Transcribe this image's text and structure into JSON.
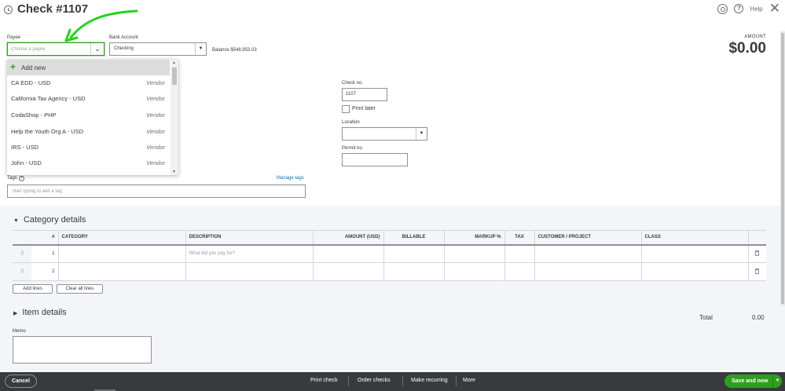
{
  "header": {
    "title": "Check #1107",
    "help_label": "Help"
  },
  "payee": {
    "label": "Payee",
    "placeholder": "Choose a payee"
  },
  "bank_account": {
    "label": "Bank Account",
    "value": "Checking",
    "balance": "Balance $548,953.03"
  },
  "amount": {
    "label": "AMOUNT",
    "value": "$0.00"
  },
  "payee_dropdown": {
    "add_new": "Add new",
    "items": [
      {
        "name": "CA EDD  - USD",
        "type": "Vendor"
      },
      {
        "name": "California Tax Agency  - USD",
        "type": "Vendor"
      },
      {
        "name": "CodaShop  - PHP",
        "type": "Vendor"
      },
      {
        "name": "Help the Youth Org A  - USD",
        "type": "Vendor"
      },
      {
        "name": "IRS  - USD",
        "type": "Vendor"
      },
      {
        "name": "John  - USD",
        "type": "Vendor"
      }
    ]
  },
  "check_no": {
    "label": "Check no.",
    "value": "1107"
  },
  "print_later": {
    "label": "Print later"
  },
  "location": {
    "label": "Location"
  },
  "permit": {
    "label": "Permit no."
  },
  "tags": {
    "label": "Tags",
    "manage": "Manage tags",
    "placeholder": "Start typing to add a tag"
  },
  "category_details": {
    "title": "Category details",
    "columns": [
      "#",
      "CATEGORY",
      "DESCRIPTION",
      "AMOUNT (USD)",
      "BILLABLE",
      "MARKUP %",
      "TAX",
      "CUSTOMER / PROJECT",
      "CLASS"
    ],
    "rows": [
      {
        "num": "1",
        "description_placeholder": "What did you pay for?"
      },
      {
        "num": "2",
        "description_placeholder": ""
      }
    ],
    "add_lines": "Add lines",
    "clear_all_lines": "Clear all lines"
  },
  "item_details": {
    "title": "Item details"
  },
  "total": {
    "label": "Total",
    "value": "0.00"
  },
  "memo": {
    "label": "Memo"
  },
  "footer": {
    "cancel": "Cancel",
    "print_check": "Print check",
    "order_checks": "Order checks",
    "make_recurring": "Make recurring",
    "more": "More",
    "save_and_new": "Save and new"
  },
  "colors": {
    "brand_green": "#2ca01c",
    "footer_bg": "#393a3d",
    "link_blue": "#0077c5"
  }
}
